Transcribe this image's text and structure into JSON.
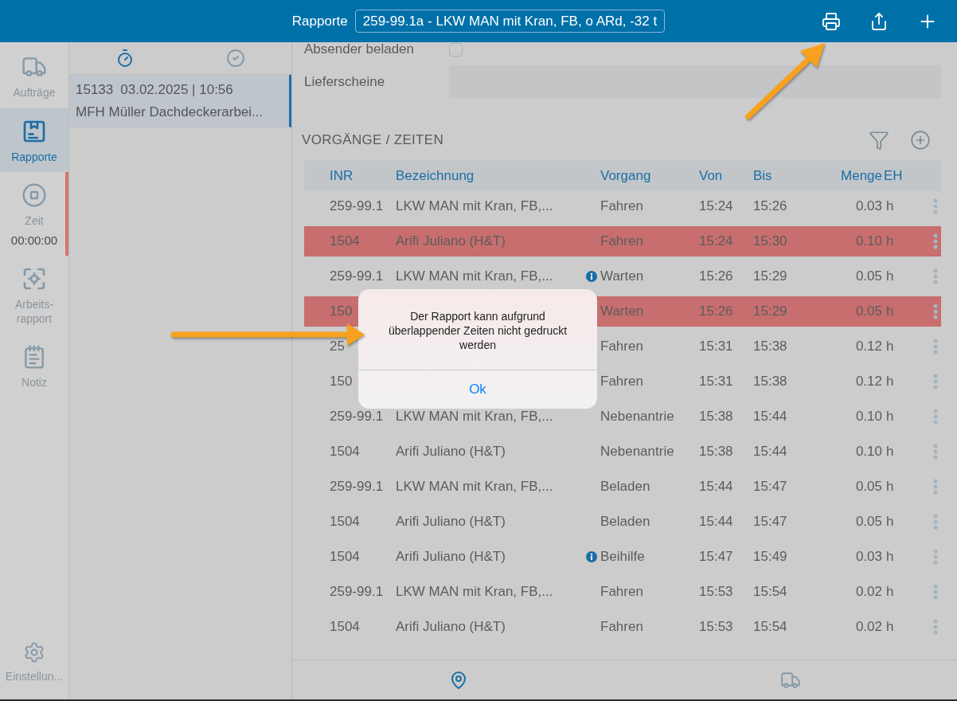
{
  "top_bar": {
    "title": "Rapporte",
    "selector_value": "259-99.1a - LKW MAN mit Kran, FB, o ARd, -32 t"
  },
  "sidebar": {
    "items": [
      {
        "label": "Aufträge",
        "selected": false,
        "alert": false
      },
      {
        "label": "Rapporte",
        "selected": true,
        "alert": false
      },
      {
        "label": "Zeit",
        "timer": "00:00:00",
        "selected": false,
        "alert": true
      },
      {
        "label": "Arbeits-rapport",
        "selected": false,
        "alert": false
      },
      {
        "label": "Notiz",
        "selected": false,
        "alert": false
      }
    ],
    "footer_item": {
      "label": "Einstellun..."
    }
  },
  "report_list": {
    "tabs": [
      {
        "selected": true
      },
      {
        "selected": false
      }
    ],
    "items": [
      {
        "number": "15133",
        "date": "03.02.2025 | 10:56",
        "title": "MFH Müller Dachdeckerarbei...",
        "selected": true
      }
    ]
  },
  "form": {
    "fields": [
      {
        "kind": "checkbox",
        "label": "Absender beladen",
        "checked": false
      },
      {
        "kind": "text",
        "label": "Lieferscheine"
      }
    ]
  },
  "section": {
    "title": "VORGÄNGE / ZEITEN"
  },
  "table": {
    "columns": [
      "INR",
      "Bezeichnung",
      "Vorgang",
      "Von",
      "Bis",
      "Menge",
      "EH"
    ],
    "rows": [
      {
        "inr": "259-99.1",
        "bezeichnung": "LKW MAN mit Kran, FB,...",
        "info": false,
        "vorgang": "Fahren",
        "von": "15:24",
        "bis": "15:26",
        "menge": "0.03",
        "eh": "h",
        "overlap": false
      },
      {
        "inr": "1504",
        "bezeichnung": "Arifi Juliano (H&T)",
        "info": false,
        "vorgang": "Fahren",
        "von": "15:24",
        "bis": "15:30",
        "menge": "0.10",
        "eh": "h",
        "overlap": true
      },
      {
        "inr": "259-99.1",
        "bezeichnung": "LKW MAN mit Kran, FB,...",
        "info": true,
        "vorgang": "Warten",
        "von": "15:26",
        "bis": "15:29",
        "menge": "0.05",
        "eh": "h",
        "overlap": false
      },
      {
        "inr": "150",
        "info": false,
        "vorgang": "Warten",
        "von": "15:26",
        "bis": "15:29",
        "menge": "0.05",
        "eh": "h",
        "overlap": true
      },
      {
        "inr": "25",
        "info": false,
        "vorgang": "Fahren",
        "von": "15:31",
        "bis": "15:38",
        "menge": "0.12",
        "eh": "h",
        "overlap": false
      },
      {
        "inr": "150",
        "info": false,
        "vorgang": "Fahren",
        "von": "15:31",
        "bis": "15:38",
        "menge": "0.12",
        "eh": "h",
        "overlap": false
      },
      {
        "inr": "259-99.1",
        "bezeichnung": "LKW MAN mit Kran, FB,...",
        "info": false,
        "vorgang": "Nebenantrie",
        "von": "15:38",
        "bis": "15:44",
        "menge": "0.10",
        "eh": "h",
        "overlap": false
      },
      {
        "inr": "1504",
        "bezeichnung": "Arifi Juliano (H&T)",
        "info": false,
        "vorgang": "Nebenantrie",
        "von": "15:38",
        "bis": "15:44",
        "menge": "0.10",
        "eh": "h",
        "overlap": false
      },
      {
        "inr": "259-99.1",
        "bezeichnung": "LKW MAN mit Kran, FB,...",
        "info": false,
        "vorgang": "Beladen",
        "von": "15:44",
        "bis": "15:47",
        "menge": "0.05",
        "eh": "h",
        "overlap": false
      },
      {
        "inr": "1504",
        "bezeichnung": "Arifi Juliano (H&T)",
        "info": false,
        "vorgang": "Beladen",
        "von": "15:44",
        "bis": "15:47",
        "menge": "0.05",
        "eh": "h",
        "overlap": false
      },
      {
        "inr": "1504",
        "bezeichnung": "Arifi Juliano (H&T)",
        "info": true,
        "vorgang": "Beihilfe",
        "von": "15:47",
        "bis": "15:49",
        "menge": "0.03",
        "eh": "h",
        "overlap": false
      },
      {
        "inr": "259-99.1",
        "bezeichnung": "LKW MAN mit Kran, FB,...",
        "info": false,
        "vorgang": "Fahren",
        "von": "15:53",
        "bis": "15:54",
        "menge": "0.02",
        "eh": "h",
        "overlap": false
      },
      {
        "inr": "1504",
        "bezeichnung": "Arifi Juliano (H&T)",
        "info": false,
        "vorgang": "Fahren",
        "von": "15:53",
        "bis": "15:54",
        "menge": "0.02",
        "eh": "h",
        "overlap": false
      }
    ]
  },
  "bottom_tabs": [
    {
      "selected": true
    },
    {
      "selected": false
    }
  ],
  "dialog": {
    "message": "Der Rapport kann aufgrund überlappender Zeiten nicht gedruckt werden",
    "button": "Ok"
  }
}
